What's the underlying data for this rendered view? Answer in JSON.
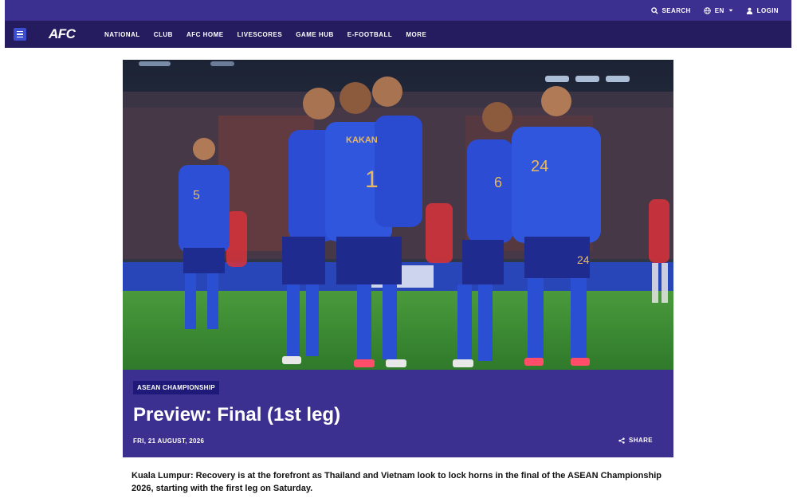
{
  "topbar": {
    "search_label": "SEARCH",
    "language_label": "EN",
    "login_label": "LOGIN"
  },
  "nav": {
    "logo_text": "AFC",
    "links": [
      "NATIONAL",
      "CLUB",
      "AFC HOME",
      "LIVESCORES",
      "GAME HUB",
      "E-FOOTBALL",
      "MORE"
    ]
  },
  "hero": {
    "jersey_names": [
      "KAKAN"
    ],
    "jersey_numbers": [
      "5",
      "1",
      "6",
      "24",
      "24"
    ]
  },
  "article": {
    "category": "ASEAN CHAMPIONSHIP",
    "title": "Preview: Final (1st leg)",
    "date": "FRI, 21 AUGUST, 2026",
    "share_label": "SHARE",
    "lede": "Kuala Lumpur: Recovery is at the forefront as Thailand and Vietnam look to lock horns in the final of the ASEAN Championship 2026, starting with the first leg on Saturday."
  },
  "colors": {
    "topbar": "#3b2f8f",
    "nav": "#241c5e",
    "card": "#3b2f8f",
    "badge": "#1f1a7a",
    "menu_button": "#3d4dcf"
  },
  "icons": [
    "search-icon",
    "globe-icon",
    "chevron-down-icon",
    "user-icon",
    "menu-icon",
    "share-icon"
  ]
}
